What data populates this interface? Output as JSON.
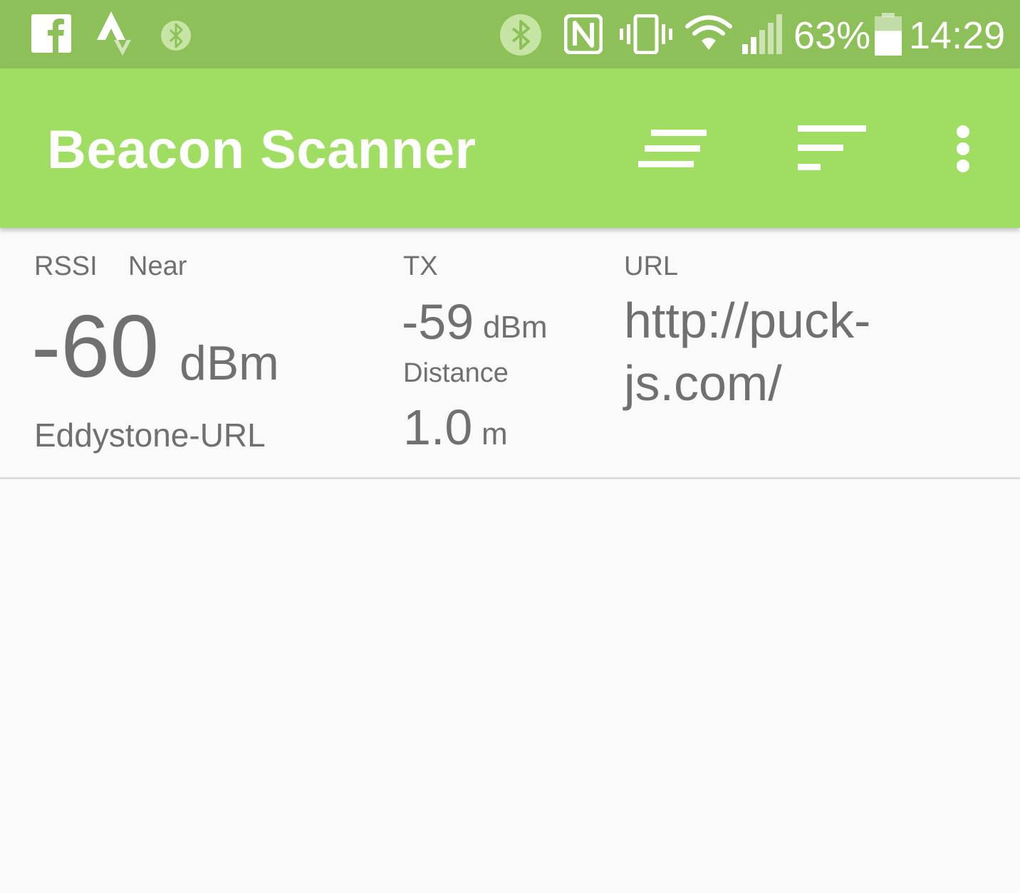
{
  "status_bar": {
    "background": "#8ec059",
    "left_icons": [
      "facebook-icon",
      "strava-icon",
      "bluetooth-app-icon"
    ],
    "right_icons": [
      "bluetooth-icon",
      "nfc-icon",
      "vibrate-icon",
      "wifi-icon",
      "signal-icon",
      "battery-icon"
    ],
    "battery_percent": "63%",
    "battery_level": 0.63,
    "time": "14:29"
  },
  "app_bar": {
    "background": "#9fde63",
    "title": "Beacon Scanner",
    "actions": [
      "filter-lines-icon",
      "sort-icon",
      "more-vert-icon"
    ]
  },
  "beacon": {
    "rssi_label": "RSSI",
    "proximity": "Near",
    "rssi_value": "-60",
    "rssi_unit": "dBm",
    "beacon_type": "Eddystone-URL",
    "tx_label": "TX",
    "tx_value": "-59",
    "tx_unit": "dBm",
    "distance_label": "Distance",
    "distance_value": "1.0",
    "distance_unit": "m",
    "url_label": "URL",
    "url_line1": "http://puck-",
    "url_line2": "js.com/"
  },
  "colors": {
    "text": "#707070",
    "background": "#fafafa",
    "divider": "#dcdcdc"
  }
}
